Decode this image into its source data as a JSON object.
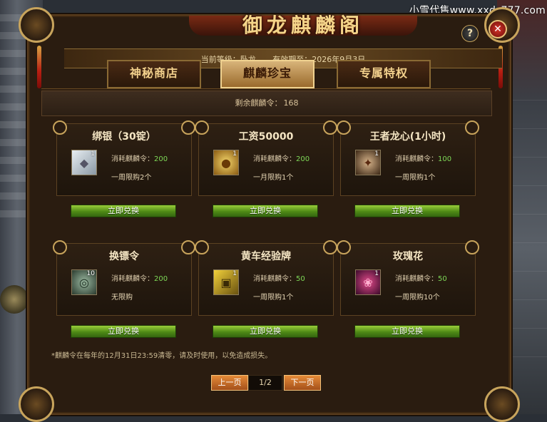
{
  "watermark": "小雪代售www.xxds777.com",
  "window": {
    "title": "御龙麒麟阁",
    "help_label": "?",
    "close_label": "✕"
  },
  "header": {
    "level_text": "当前等级：卧龙",
    "expiry_text": "有效期至：2026年9月3日"
  },
  "tabs": [
    {
      "label": "神秘商店",
      "active": false
    },
    {
      "label": "麒麟珍宝",
      "active": true
    },
    {
      "label": "专属特权",
      "active": false
    }
  ],
  "remaining": {
    "label": "剩余麒麟令：",
    "value": "168"
  },
  "cost_label": "消耗麒麟令：",
  "items": [
    {
      "name": "绑银（30锭）",
      "icon": "silver-ingot-icon",
      "count": "1",
      "cost": "200",
      "limit": "一周限购2个"
    },
    {
      "name": "工资50000",
      "icon": "gold-coins-icon",
      "count": "1",
      "cost": "200",
      "limit": "一月限购1个"
    },
    {
      "name": "王者龙心(1小时)",
      "icon": "dragon-heart-icon",
      "count": "1",
      "cost": "100",
      "limit": "一周限购1个"
    },
    {
      "name": "换镖令",
      "icon": "escort-token-icon",
      "count": "10",
      "cost": "200",
      "limit": "无限购"
    },
    {
      "name": "黄车经验牌",
      "icon": "yellow-cart-exp-icon",
      "count": "1",
      "cost": "50",
      "limit": "一周限购1个"
    },
    {
      "name": "玫瑰花",
      "icon": "rose-icon",
      "count": "1",
      "cost": "50",
      "limit": "一周限购10个"
    }
  ],
  "redeem_label": "立即兑换",
  "footnote": "*麒麟令在每年的12月31日23:59清零，请及时使用，以免造成损失。",
  "pagination": {
    "prev_label": "上一页",
    "next_label": "下一页",
    "current": "1/2"
  }
}
